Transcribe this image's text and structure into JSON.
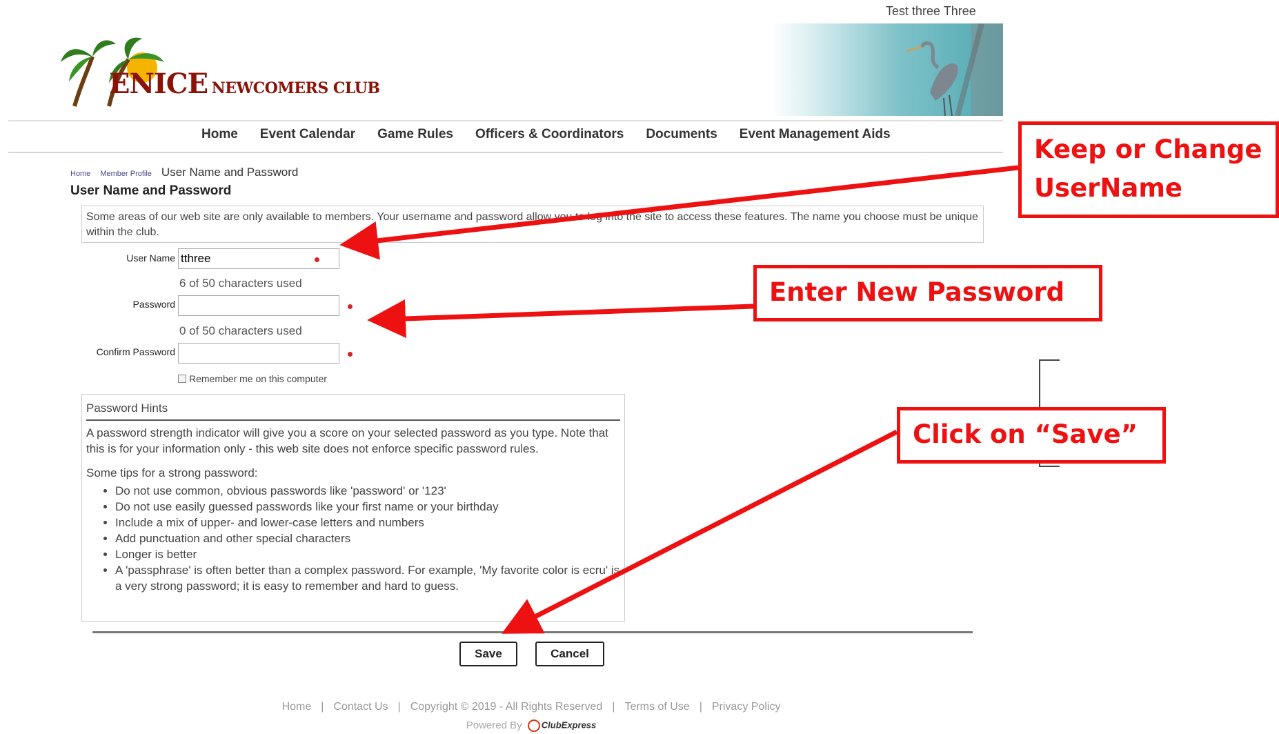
{
  "header": {
    "user_name": "Test three Three",
    "logo_big": "ENICE",
    "logo_small": "NEWCOMERS CLUB"
  },
  "nav": {
    "items": [
      "Home",
      "Event Calendar",
      "Game Rules",
      "Officers & Coordinators",
      "Documents",
      "Event Management Aids"
    ]
  },
  "breadcrumb": {
    "home": "Home",
    "member_profile": "Member Profile",
    "current": "User Name and Password"
  },
  "page": {
    "title": "User Name and Password",
    "intro": "Some areas of our web site are only available to members. Your username and password allow you to log into the site to access these features. The name you choose must be unique within the club."
  },
  "form": {
    "username_label": "User Name",
    "username_value": "tthree",
    "username_count": "6 of 50 characters used",
    "password_label": "Password",
    "password_value": "",
    "password_count": "0 of 50 characters used",
    "confirm_label": "Confirm Password",
    "confirm_value": "",
    "remember_label": "Remember me on this computer"
  },
  "hints": {
    "title": "Password Hints",
    "text": "A password strength indicator will give you a score on your selected password as you type. Note that this is for your information only - this web site does not enforce specific password rules.",
    "tips_heading": "Some tips for a strong password:",
    "tips": [
      "Do not use common, obvious passwords like 'password' or '123'",
      "Do not use easily guessed passwords like your first name or your birthday",
      "Include a mix of upper- and lower-case letters and numbers",
      "Add punctuation and other special characters",
      "Longer is better",
      "A 'passphrase' is often better than a complex password. For example, 'My favorite color is ecru' is a very strong password; it is easy to remember and hard to guess."
    ]
  },
  "buttons": {
    "save": "Save",
    "cancel": "Cancel"
  },
  "footer": {
    "links": [
      "Home",
      "Contact Us",
      "Copyright © 2019 - All Rights Reserved",
      "Terms of Use",
      "Privacy Policy"
    ],
    "powered_by": "Powered By",
    "brand": "ClubExpress"
  },
  "annotations": {
    "username": "Keep or Change\n UserName",
    "password": "Enter New Password",
    "save": "Click on “Save”",
    "color": "#ee1111"
  }
}
